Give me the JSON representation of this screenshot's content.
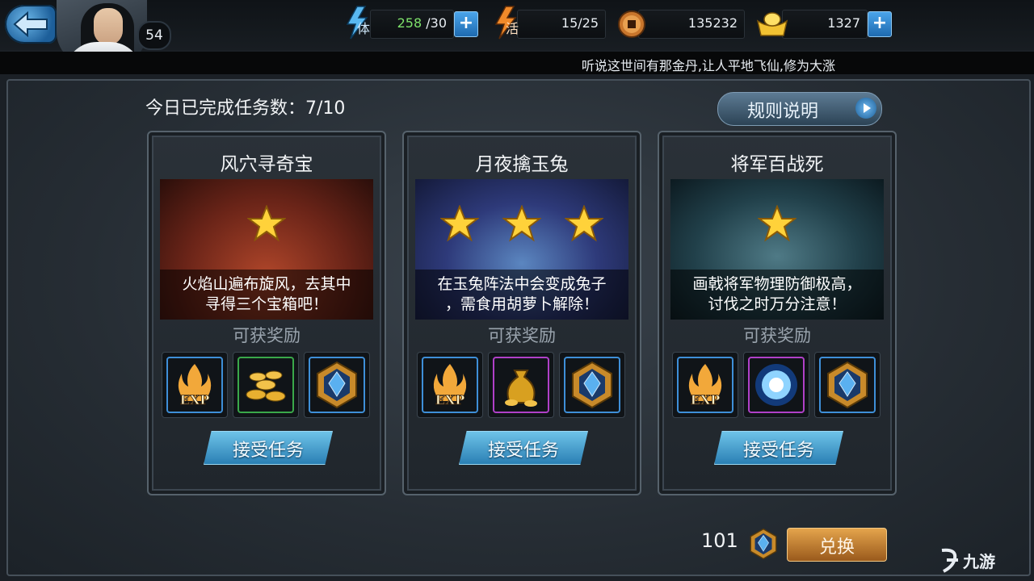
{
  "player": {
    "level": "54"
  },
  "resources": {
    "stamina": {
      "icon": "lightning-icon",
      "label": "体",
      "current": "258",
      "max": "/30"
    },
    "vitality": {
      "icon": "lightning-icon",
      "label": "活",
      "value": "15/25"
    },
    "coins": {
      "icon": "copper-coin-icon",
      "value": "135232"
    },
    "ingots": {
      "icon": "gold-ingot-icon",
      "value": "1327"
    }
  },
  "ticker": "听说这世间有那金丹,让人平地飞仙,修为大涨",
  "completed_text": "今日已完成任务数：7/10",
  "rules_button": "规则说明",
  "reward_label": "可获奖励",
  "accept_label": "接受任务",
  "tasks": [
    {
      "title": "风穴寻奇宝",
      "stars": 1,
      "desc_line1": "火焰山遍布旋风，去其中",
      "desc_line2": "寻得三个宝箱吧！",
      "rewards": [
        "exp-icon",
        "gold-coins-icon",
        "blue-gem-icon"
      ]
    },
    {
      "title": "月夜擒玉兔",
      "stars": 3,
      "desc_line1": "在玉兔阵法中会变成兔子",
      "desc_line2": "，需食用胡萝卜解除！",
      "rewards": [
        "exp-icon",
        "gold-sack-icon",
        "blue-gem-icon"
      ]
    },
    {
      "title": "将军百战死",
      "stars": 1,
      "desc_line1": "画戟将军物理防御极高，",
      "desc_line2": "讨伐之时万分注意！",
      "rewards": [
        "exp-icon",
        "spirit-orb-icon",
        "blue-gem-icon"
      ]
    }
  ],
  "exp_text": "EXP",
  "token_count": "101",
  "exchange_button": "兑换",
  "watermark": "九游"
}
